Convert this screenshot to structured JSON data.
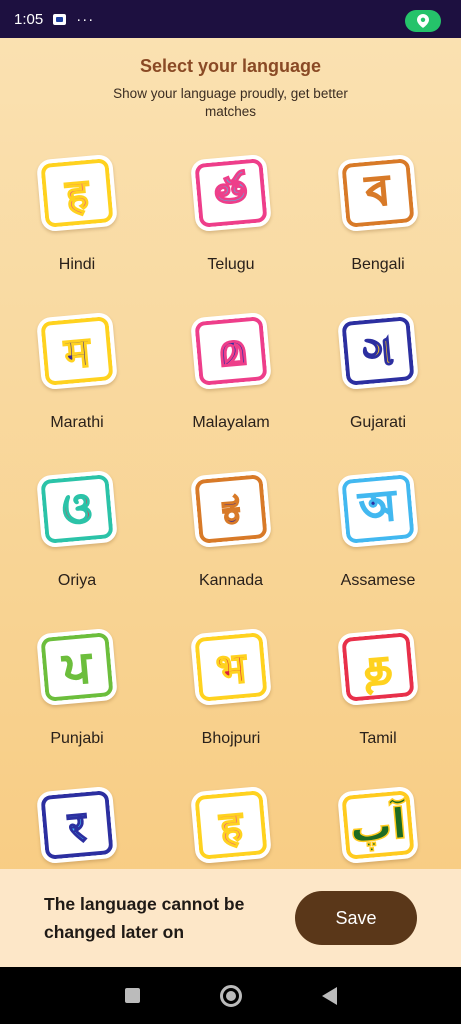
{
  "status_bar": {
    "time": "1:05",
    "dots": "···"
  },
  "header": {
    "title": "Select your language",
    "subtitle": "Show your language proudly, get better matches"
  },
  "languages": [
    {
      "label": "Hindi",
      "glyph": "ह",
      "fg": "#e84a8e",
      "bg": "#ffd21f",
      "border": "#ffd21f"
    },
    {
      "label": "Telugu",
      "glyph": "త",
      "fg": "#3ec4ea",
      "bg": "#ee3e8a",
      "border": "#ee3e8a"
    },
    {
      "label": "Bengali",
      "glyph": "ব",
      "fg": "#ffcb1f",
      "bg": "#d87a28",
      "border": "#d87a28"
    },
    {
      "label": "Marathi",
      "glyph": "म",
      "fg": "#3b2a90",
      "bg": "#ffd21f",
      "border": "#ffd21f"
    },
    {
      "label": "Malayalam",
      "glyph": "മ",
      "fg": "#2c2fa0",
      "bg": "#ee3e8a",
      "border": "#ee3e8a"
    },
    {
      "label": "Gujarati",
      "glyph": "ગ",
      "fg": "#ffcb1f",
      "bg": "#2c2fa0",
      "border": "#2c2fa0"
    },
    {
      "label": "Oriya",
      "glyph": "ଓ",
      "fg": "#e83050",
      "bg": "#2bc3a8",
      "border": "#2bc3a8"
    },
    {
      "label": "Kannada",
      "glyph": "ಕ",
      "fg": "#3b2a90",
      "bg": "#d87a28",
      "border": "#d87a28"
    },
    {
      "label": "Assamese",
      "glyph": "অ",
      "fg": "#2c2fa0",
      "bg": "#42b8f0",
      "border": "#42b8f0"
    },
    {
      "label": "Punjabi",
      "glyph": "ਪ",
      "fg": "#ffd21f",
      "bg": "#6cbe3c",
      "border": "#6cbe3c"
    },
    {
      "label": "Bhojpuri",
      "glyph": "भ",
      "fg": "#d8203c",
      "bg": "#ffd21f",
      "border": "#ffd21f"
    },
    {
      "label": "Tamil",
      "glyph": "த",
      "fg": "#e8304a",
      "bg": "#e8304a",
      "border": "#e8304a"
    },
    {
      "label": "",
      "glyph": "र",
      "fg": "#42b8f0",
      "bg": "#2c2fa0",
      "border": "#2c2fa0"
    },
    {
      "label": "",
      "glyph": "ह",
      "fg": "#e84a8e",
      "bg": "#ffd21f",
      "border": "#ffd21f"
    },
    {
      "label": "",
      "glyph": "آپ",
      "fg": "#1e6b22",
      "bg": "#ffcb1f",
      "border": "#ffcb1f"
    }
  ],
  "footer": {
    "note": "The language cannot be changed later on",
    "save_label": "Save"
  }
}
